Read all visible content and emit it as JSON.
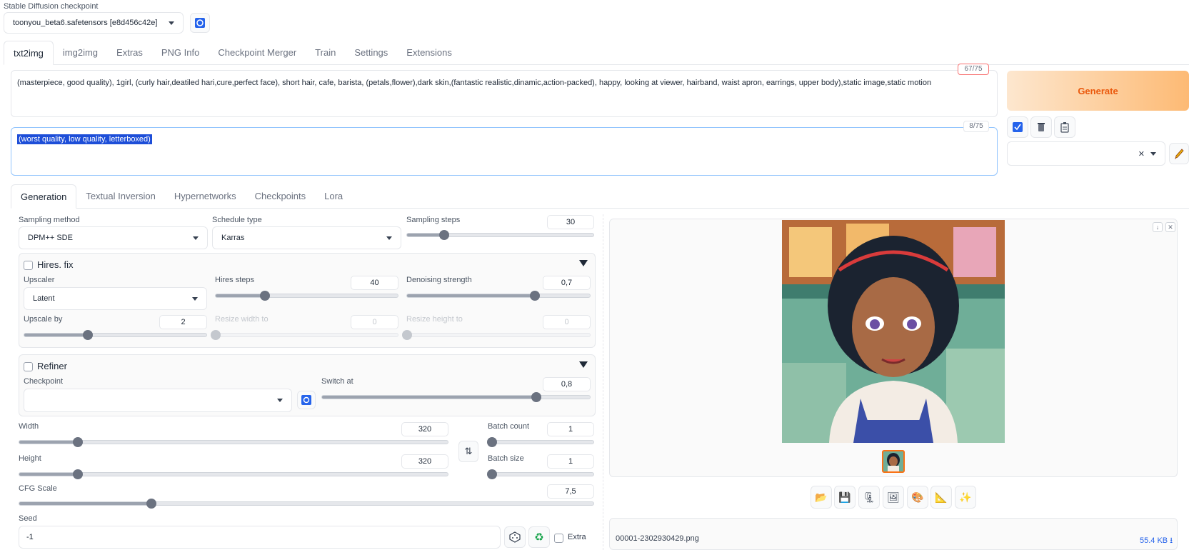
{
  "checkpoint": {
    "label": "Stable Diffusion checkpoint",
    "value": "toonyou_beta6.safetensors [e8d456c42e]"
  },
  "tabs": [
    "txt2img",
    "img2img",
    "Extras",
    "PNG Info",
    "Checkpoint Merger",
    "Train",
    "Settings",
    "Extensions"
  ],
  "prompt": {
    "text": "(masterpiece, good quality), 1girl, (curly hair,deatiled hari,cure,perfect face), short hair, cafe, barista, (petals,flower),dark skin,(fantastic realistic,dinamic,action-packed), happy, looking at viewer, hairband, waist apron, earrings, upper body),static image,static motion",
    "counter": "67/75"
  },
  "negative": {
    "text": "(worst quality, low quality, letterboxed)",
    "counter": "8/75"
  },
  "generate_label": "Generate",
  "subtabs": [
    "Generation",
    "Textual Inversion",
    "Hypernetworks",
    "Checkpoints",
    "Lora"
  ],
  "sampling": {
    "method_label": "Sampling method",
    "method": "DPM++ SDE",
    "schedule_label": "Schedule type",
    "schedule": "Karras",
    "steps_label": "Sampling steps",
    "steps": "30",
    "steps_frac": 0.2
  },
  "hires": {
    "label": "Hires. fix",
    "upscaler_label": "Upscaler",
    "upscaler": "Latent",
    "steps_label": "Hires steps",
    "steps": "40",
    "steps_frac": 0.27,
    "denoise_label": "Denoising strength",
    "denoise": "0,7",
    "denoise_frac": 0.7,
    "upscale_by_label": "Upscale by",
    "upscale_by": "2",
    "upscale_frac": 0.35,
    "width_label": "Resize width to",
    "width": "0",
    "height_label": "Resize height to",
    "height": "0"
  },
  "refiner": {
    "label": "Refiner",
    "checkpoint_label": "Checkpoint",
    "switch_label": "Switch at",
    "switch": "0,8",
    "switch_frac": 0.8
  },
  "dims": {
    "width_label": "Width",
    "width": "320",
    "width_frac": 0.136,
    "height_label": "Height",
    "height": "320",
    "height_frac": 0.136,
    "batch_count_label": "Batch count",
    "batch_count": "1",
    "batch_size_label": "Batch size",
    "batch_size": "1"
  },
  "cfg": {
    "label": "CFG Scale",
    "value": "7,5",
    "frac": 0.23
  },
  "seed": {
    "label": "Seed",
    "value": "-1",
    "extra_label": "Extra"
  },
  "output": {
    "filename": "00001-2302930429.png",
    "size": "55.4 KB"
  }
}
